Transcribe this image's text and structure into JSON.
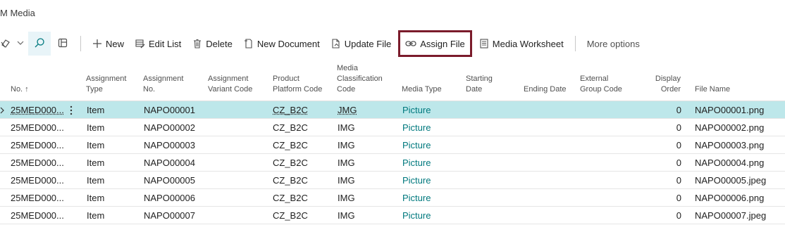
{
  "page": {
    "title": "M Media"
  },
  "toolbar": {
    "new_label": "New",
    "edit_list_label": "Edit List",
    "delete_label": "Delete",
    "new_document_label": "New Document",
    "update_file_label": "Update File",
    "assign_file_label": "Assign File",
    "media_worksheet_label": "Media Worksheet",
    "more_options_label": "More options"
  },
  "table": {
    "headers": {
      "no": "No. ↑",
      "assignment_type_1": "Assignment",
      "assignment_type_2": "Type",
      "assignment_no_1": "Assignment",
      "assignment_no_2": "No.",
      "variant_1": "Assignment",
      "variant_2": "Variant Code",
      "platform_1": "Product",
      "platform_2": "Platform Code",
      "class_1": "Media",
      "class_2": "Classification",
      "class_3": "Code",
      "media_type": "Media Type",
      "starting_1": "Starting",
      "starting_2": "Date",
      "ending_date": "Ending Date",
      "external_1": "External",
      "external_2": "Group Code",
      "display_1": "Display",
      "display_2": "Order",
      "file_name": "File Name"
    },
    "rows": [
      {
        "no": "25MED000...",
        "assignment_type": "Item",
        "assignment_no": "NAPO00001",
        "variant_code": "",
        "platform_code": "CZ_B2C",
        "classification_code": "JMG",
        "media_type": "Picture",
        "starting_date": "",
        "ending_date": "",
        "external_group_code": "",
        "display_order": "0",
        "file_name": "NAPO00001.png"
      },
      {
        "no": "25MED000...",
        "assignment_type": "Item",
        "assignment_no": "NAPO00002",
        "variant_code": "",
        "platform_code": "CZ_B2C",
        "classification_code": "IMG",
        "media_type": "Picture",
        "starting_date": "",
        "ending_date": "",
        "external_group_code": "",
        "display_order": "0",
        "file_name": "NAPO00002.png"
      },
      {
        "no": "25MED000...",
        "assignment_type": "Item",
        "assignment_no": "NAPO00003",
        "variant_code": "",
        "platform_code": "CZ_B2C",
        "classification_code": "IMG",
        "media_type": "Picture",
        "starting_date": "",
        "ending_date": "",
        "external_group_code": "",
        "display_order": "0",
        "file_name": "NAPO00003.png"
      },
      {
        "no": "25MED000...",
        "assignment_type": "Item",
        "assignment_no": "NAPO00004",
        "variant_code": "",
        "platform_code": "CZ_B2C",
        "classification_code": "IMG",
        "media_type": "Picture",
        "starting_date": "",
        "ending_date": "",
        "external_group_code": "",
        "display_order": "0",
        "file_name": "NAPO00004.png"
      },
      {
        "no": "25MED000...",
        "assignment_type": "Item",
        "assignment_no": "NAPO00005",
        "variant_code": "",
        "platform_code": "CZ_B2C",
        "classification_code": "IMG",
        "media_type": "Picture",
        "starting_date": "",
        "ending_date": "",
        "external_group_code": "",
        "display_order": "0",
        "file_name": "NAPO00005.jpeg"
      },
      {
        "no": "25MED000...",
        "assignment_type": "Item",
        "assignment_no": "NAPO00006",
        "variant_code": "",
        "platform_code": "CZ_B2C",
        "classification_code": "IMG",
        "media_type": "Picture",
        "starting_date": "",
        "ending_date": "",
        "external_group_code": "",
        "display_order": "0",
        "file_name": "NAPO00006.png"
      },
      {
        "no": "25MED000...",
        "assignment_type": "Item",
        "assignment_no": "NAPO00007",
        "variant_code": "",
        "platform_code": "CZ_B2C",
        "classification_code": "IMG",
        "media_type": "Picture",
        "starting_date": "",
        "ending_date": "",
        "external_group_code": "",
        "display_order": "0",
        "file_name": "NAPO00007.jpeg"
      }
    ]
  },
  "colors": {
    "accent": "#00797e",
    "selected_row": "#bde7ea",
    "highlight_border": "#7b1b2b"
  },
  "icons": [
    "view-switch-icon",
    "chevron-down-icon",
    "search-icon",
    "layout-icon",
    "plus-icon",
    "edit-list-icon",
    "trash-icon",
    "new-document-icon",
    "update-file-icon",
    "link-icon",
    "worksheet-icon",
    "row-arrow-icon",
    "row-menu-icon"
  ]
}
